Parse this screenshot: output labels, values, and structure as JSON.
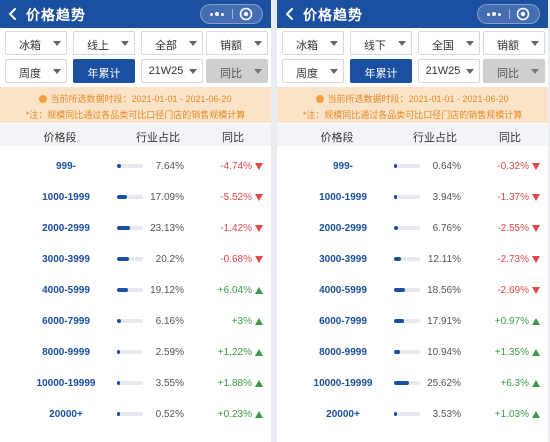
{
  "panels": [
    {
      "header": {
        "title": "价格趋势",
        "back_icon": "back-chevron-icon",
        "more_icon": "more-dots-icon",
        "target_icon": "target-icon"
      },
      "filters": {
        "row1": [
          {
            "label": "冰箱",
            "type": "dropdown"
          },
          {
            "label": "线上",
            "type": "dropdown"
          },
          {
            "label": "全部",
            "type": "dropdown"
          },
          {
            "label": "销额",
            "type": "dropdown"
          }
        ],
        "row2": [
          {
            "label": "周度",
            "type": "dropdown"
          },
          {
            "label": "年累计",
            "type": "primary"
          },
          {
            "label": "21W25",
            "type": "dropdown"
          },
          {
            "label": "同比",
            "type": "disabled"
          }
        ]
      },
      "notice": {
        "line1": "当前所选数据时段：2021-01-01 - 2021-06-20",
        "line2": "*注：规模同比通过各品类可比口径门店的销售规模计算"
      },
      "table": {
        "headers": [
          "价格段",
          "行业占比",
          "同比"
        ],
        "rows": [
          {
            "segment": "999-",
            "share": "7.64%",
            "share_value": 7.64,
            "yoy": "-4.74%",
            "dir": "down"
          },
          {
            "segment": "1000-1999",
            "share": "17.09%",
            "share_value": 17.09,
            "yoy": "-5.52%",
            "dir": "down"
          },
          {
            "segment": "2000-2999",
            "share": "23.13%",
            "share_value": 23.13,
            "yoy": "-1.42%",
            "dir": "down"
          },
          {
            "segment": "3000-3999",
            "share": "20.2%",
            "share_value": 20.2,
            "yoy": "-0.68%",
            "dir": "down"
          },
          {
            "segment": "4000-5999",
            "share": "19.12%",
            "share_value": 19.12,
            "yoy": "+6.04%",
            "dir": "up"
          },
          {
            "segment": "6000-7999",
            "share": "6.16%",
            "share_value": 6.16,
            "yoy": "+3%",
            "dir": "up"
          },
          {
            "segment": "8000-9999",
            "share": "2.59%",
            "share_value": 2.59,
            "yoy": "+1.22%",
            "dir": "up"
          },
          {
            "segment": "10000-19999",
            "share": "3.55%",
            "share_value": 3.55,
            "yoy": "+1.88%",
            "dir": "up"
          },
          {
            "segment": "20000+",
            "share": "0.52%",
            "share_value": 0.52,
            "yoy": "+0.23%",
            "dir": "up"
          }
        ]
      }
    },
    {
      "header": {
        "title": "价格趋势",
        "back_icon": "back-chevron-icon",
        "more_icon": "more-dots-icon",
        "target_icon": "target-icon"
      },
      "filters": {
        "row1": [
          {
            "label": "冰箱",
            "type": "dropdown"
          },
          {
            "label": "线下",
            "type": "dropdown"
          },
          {
            "label": "全国",
            "type": "dropdown"
          },
          {
            "label": "销额",
            "type": "dropdown"
          }
        ],
        "row2": [
          {
            "label": "周度",
            "type": "dropdown"
          },
          {
            "label": "年累计",
            "type": "primary"
          },
          {
            "label": "21W25",
            "type": "dropdown"
          },
          {
            "label": "同比",
            "type": "disabled"
          }
        ]
      },
      "notice": {
        "line1": "当前所选数据时段：2021-01-01 - 2021-06-20",
        "line2": "*注：规模同比通过各品类可比口径门店的销售规模计算"
      },
      "table": {
        "headers": [
          "价格段",
          "行业占比",
          "同比"
        ],
        "rows": [
          {
            "segment": "999-",
            "share": "0.64%",
            "share_value": 0.64,
            "yoy": "-0.32%",
            "dir": "down"
          },
          {
            "segment": "1000-1999",
            "share": "3.94%",
            "share_value": 3.94,
            "yoy": "-1.37%",
            "dir": "down"
          },
          {
            "segment": "2000-2999",
            "share": "6.76%",
            "share_value": 6.76,
            "yoy": "-2.55%",
            "dir": "down"
          },
          {
            "segment": "3000-3999",
            "share": "12.11%",
            "share_value": 12.11,
            "yoy": "-2.73%",
            "dir": "down"
          },
          {
            "segment": "4000-5999",
            "share": "18.56%",
            "share_value": 18.56,
            "yoy": "-2.69%",
            "dir": "down"
          },
          {
            "segment": "6000-7999",
            "share": "17.91%",
            "share_value": 17.91,
            "yoy": "+0.97%",
            "dir": "up"
          },
          {
            "segment": "8000-9999",
            "share": "10.94%",
            "share_value": 10.94,
            "yoy": "+1.35%",
            "dir": "up"
          },
          {
            "segment": "10000-19999",
            "share": "25.62%",
            "share_value": 25.62,
            "yoy": "+6.3%",
            "dir": "up"
          },
          {
            "segment": "20000+",
            "share": "3.53%",
            "share_value": 3.53,
            "yoy": "+1.03%",
            "dir": "up"
          }
        ]
      }
    }
  ],
  "colors": {
    "header_bg": "#1b4fa0",
    "primary": "#1b4fa0",
    "notice_bg": "#fbe3c8",
    "notice_text": "#e08a2a",
    "negative": "#e04848",
    "positive": "#3a9a47"
  }
}
